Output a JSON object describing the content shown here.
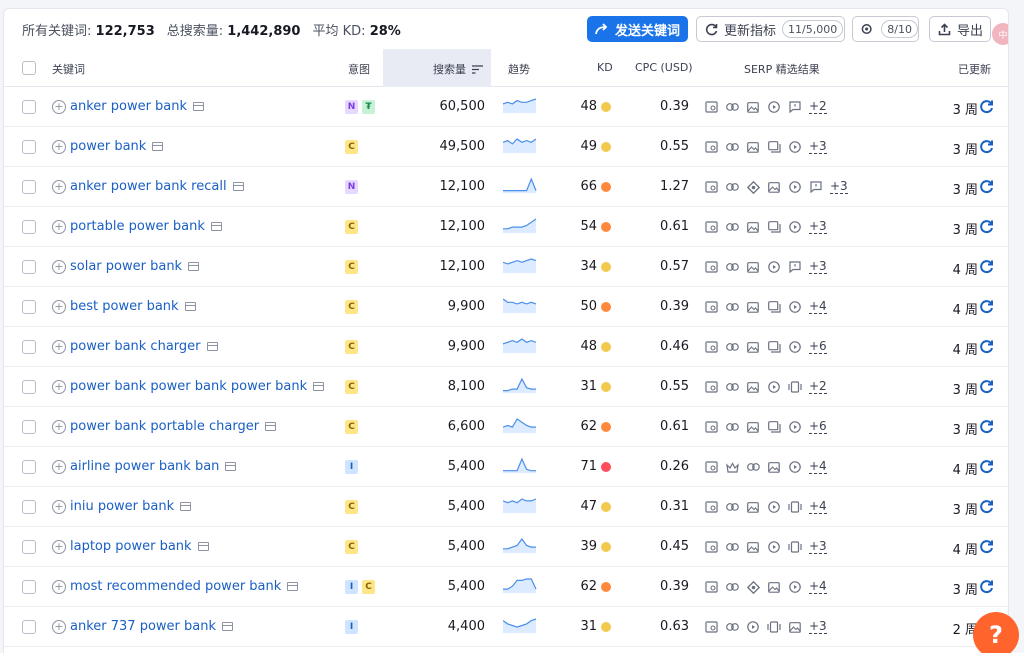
{
  "stats": {
    "all_keywords_label": "所有关键词:",
    "all_keywords_value": "122,753",
    "total_volume_label": "总搜索量:",
    "total_volume_value": "1,442,890",
    "avg_kd_label": "平均 KD:",
    "avg_kd_value": "28%"
  },
  "toolbar": {
    "send_label": "发送关键词",
    "update_label": "更新指标",
    "update_quota": "11/5,000",
    "settings_count": "8/10",
    "export_label": "导出",
    "corner_badge": "中"
  },
  "columns": {
    "keyword": "关键词",
    "intent": "意图",
    "volume": "搜索量",
    "trend": "趋势",
    "kd": "KD",
    "cpc": "CPC (USD)",
    "serp": "SERP 精选结果",
    "updated": "已更新"
  },
  "colors": {
    "accent": "#1a73e8",
    "kd_green_easy": "#f2c94c",
    "kd_orange": "#ff8a3d",
    "kd_red": "#ff4d5e",
    "intent_N": "#e6d8ff",
    "intent_C": "#fde68a",
    "intent_I": "#cfe4ff",
    "intent_T": "#c8f2d8"
  },
  "rows": [
    {
      "keyword": "anker power bank",
      "intents": [
        "N",
        "₮"
      ],
      "volume": "60,500",
      "trend": [
        5,
        6,
        5,
        7,
        6,
        6,
        7,
        8
      ],
      "kd": "48",
      "kd_color": "#f2c94c",
      "cpc": "0.39",
      "features": [
        "img-icon",
        "link-icon",
        "image-icon",
        "video-icon",
        "review-icon"
      ],
      "more": "+2",
      "updated": "3 周"
    },
    {
      "keyword": "power bank",
      "intents": [
        "C"
      ],
      "volume": "49,500",
      "trend": [
        6,
        7,
        5,
        8,
        6,
        7,
        6,
        8
      ],
      "kd": "49",
      "kd_color": "#f2c94c",
      "cpc": "0.55",
      "features": [
        "img-icon",
        "link-icon",
        "image-icon",
        "gallery-icon",
        "video-icon"
      ],
      "more": "+3",
      "updated": "3 周"
    },
    {
      "keyword": "anker power bank recall",
      "intents": [
        "N"
      ],
      "volume": "12,100",
      "trend": [
        1,
        1,
        1,
        1,
        1,
        1,
        9,
        1
      ],
      "kd": "66",
      "kd_color": "#ff8a3d",
      "cpc": "1.27",
      "features": [
        "img-icon",
        "link-icon",
        "knowledge-icon",
        "image-icon",
        "video-icon",
        "review-icon"
      ],
      "more": "+3",
      "updated": "3 周"
    },
    {
      "keyword": "portable power bank",
      "intents": [
        "C"
      ],
      "volume": "12,100",
      "trend": [
        2,
        2,
        3,
        3,
        3,
        4,
        6,
        8
      ],
      "kd": "54",
      "kd_color": "#ff8a3d",
      "cpc": "0.61",
      "features": [
        "img-icon",
        "link-icon",
        "image-icon",
        "gallery-icon",
        "video-icon"
      ],
      "more": "+3",
      "updated": "3 周"
    },
    {
      "keyword": "solar power bank",
      "intents": [
        "C"
      ],
      "volume": "12,100",
      "trend": [
        6,
        5,
        6,
        7,
        6,
        7,
        8,
        7
      ],
      "kd": "34",
      "kd_color": "#f2c94c",
      "cpc": "0.57",
      "features": [
        "img-icon",
        "link-icon",
        "image-icon",
        "video-icon",
        "review-icon"
      ],
      "more": "+3",
      "updated": "4 周"
    },
    {
      "keyword": "best power bank",
      "intents": [
        "C"
      ],
      "volume": "9,900",
      "trend": [
        8,
        6,
        6,
        5,
        6,
        5,
        6,
        5
      ],
      "kd": "50",
      "kd_color": "#ff8a3d",
      "cpc": "0.39",
      "features": [
        "img-icon",
        "link-icon",
        "image-icon",
        "gallery-icon",
        "video-icon"
      ],
      "more": "+4",
      "updated": "4 周"
    },
    {
      "keyword": "power bank charger",
      "intents": [
        "C"
      ],
      "volume": "9,900",
      "trend": [
        5,
        6,
        7,
        6,
        8,
        6,
        7,
        6
      ],
      "kd": "48",
      "kd_color": "#f2c94c",
      "cpc": "0.46",
      "features": [
        "img-icon",
        "link-icon",
        "image-icon",
        "gallery-icon",
        "video-icon"
      ],
      "more": "+6",
      "updated": "4 周"
    },
    {
      "keyword": "power bank power bank power bank",
      "intents": [
        "C"
      ],
      "volume": "8,100",
      "trend": [
        1,
        1,
        2,
        2,
        9,
        3,
        2,
        2
      ],
      "kd": "31",
      "kd_color": "#f2c94c",
      "cpc": "0.55",
      "features": [
        "img-icon",
        "link-icon",
        "image-icon",
        "video-icon",
        "carousel-icon"
      ],
      "more": "+2",
      "updated": "3 周"
    },
    {
      "keyword": "power bank portable charger",
      "intents": [
        "C"
      ],
      "volume": "6,600",
      "trend": [
        3,
        4,
        3,
        8,
        6,
        4,
        3,
        3
      ],
      "kd": "62",
      "kd_color": "#ff8a3d",
      "cpc": "0.61",
      "features": [
        "img-icon",
        "link-icon",
        "image-icon",
        "gallery-icon",
        "video-icon"
      ],
      "more": "+6",
      "updated": "3 周"
    },
    {
      "keyword": "airline power bank ban",
      "intents": [
        "I"
      ],
      "volume": "5,400",
      "trend": [
        1,
        1,
        1,
        1,
        10,
        2,
        1,
        1
      ],
      "kd": "71",
      "kd_color": "#ff4d5e",
      "cpc": "0.26",
      "features": [
        "img-icon",
        "crown-icon",
        "link-icon",
        "image-icon",
        "video-icon"
      ],
      "more": "+4",
      "updated": "4 周"
    },
    {
      "keyword": "iniu power bank",
      "intents": [
        "C"
      ],
      "volume": "5,400",
      "trend": [
        6,
        5,
        6,
        5,
        7,
        6,
        6,
        7
      ],
      "kd": "47",
      "kd_color": "#f2c94c",
      "cpc": "0.31",
      "features": [
        "img-icon",
        "link-icon",
        "image-icon",
        "video-icon",
        "carousel-icon"
      ],
      "more": "+4",
      "updated": "3 周"
    },
    {
      "keyword": "laptop power bank",
      "intents": [
        "C"
      ],
      "volume": "5,400",
      "trend": [
        2,
        2,
        3,
        4,
        8,
        4,
        3,
        3
      ],
      "kd": "39",
      "kd_color": "#f2c94c",
      "cpc": "0.45",
      "features": [
        "img-icon",
        "link-icon",
        "image-icon",
        "video-icon",
        "carousel-icon"
      ],
      "more": "+3",
      "updated": "4 周"
    },
    {
      "keyword": "most recommended power bank",
      "intents": [
        "I",
        "C"
      ],
      "volume": "5,400",
      "trend": [
        2,
        2,
        4,
        8,
        8,
        9,
        9,
        2
      ],
      "kd": "62",
      "kd_color": "#ff8a3d",
      "cpc": "0.39",
      "features": [
        "img-icon",
        "link-icon",
        "knowledge-icon",
        "image-icon",
        "video-icon"
      ],
      "more": "+4",
      "updated": "3 周"
    },
    {
      "keyword": "anker 737 power bank",
      "intents": [
        "I"
      ],
      "volume": "4,400",
      "trend": [
        7,
        5,
        4,
        3,
        4,
        5,
        7,
        8
      ],
      "kd": "31",
      "kd_color": "#f2c94c",
      "cpc": "0.63",
      "features": [
        "img-icon",
        "link-icon",
        "video-icon",
        "carousel-icon",
        "image-icon"
      ],
      "more": "+3",
      "updated": "2 周"
    }
  ],
  "help_label": "?"
}
